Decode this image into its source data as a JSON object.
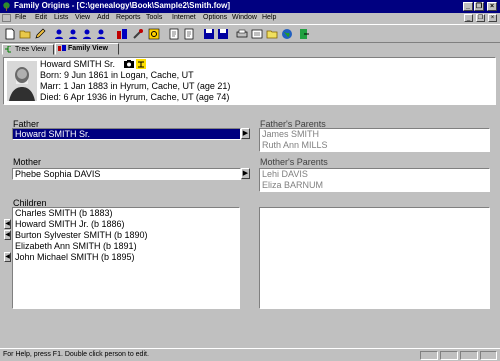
{
  "window": {
    "title": "Family Origins - [C:\\genealogy\\Book\\Sample2\\Smith.fow]",
    "minimize": "_",
    "restore": "❐",
    "close": "×"
  },
  "menu": {
    "items": [
      "File",
      "Edit",
      "Lists",
      "View",
      "Add",
      "Reports",
      "Tools",
      "Internet",
      "Options",
      "Window",
      "Help"
    ]
  },
  "tabs": {
    "tree": "Tree View",
    "family": "Family View"
  },
  "person": {
    "name": "Howard SMITH Sr.",
    "born": "Born: 9 Jun 1861 in Logan, Cache, UT",
    "married": "Marr: 1 Jan 1883 in Hyrum, Cache, UT (age 21)",
    "died": "Died: 6 Apr 1936 in Hyrum, Cache, UT (age 74)"
  },
  "father": {
    "label": "Father",
    "value": "Howard SMITH Sr.",
    "parents_label": "Father's Parents",
    "parents": [
      "James SMITH",
      "Ruth Ann MILLS"
    ]
  },
  "mother": {
    "label": "Mother",
    "value": "Phebe Sophia DAVIS",
    "parents_label": "Mother's Parents",
    "parents": [
      "Lehi DAVIS",
      "Eliza BARNUM"
    ]
  },
  "children": {
    "label": "Children",
    "items": [
      "Charles SMITH  (b 1883)",
      "Howard SMITH Jr.  (b 1886)",
      "Burton Sylvester SMITH  (b 1890)",
      "Elizabeth Ann SMITH  (b 1891)",
      "John Michael SMITH  (b 1895)"
    ]
  },
  "status": {
    "text": "For Help, press F1.  Double click person to edit."
  },
  "colors": {
    "titlebar": "#000080",
    "selection": "#000080",
    "face": "#c0c0c0"
  }
}
